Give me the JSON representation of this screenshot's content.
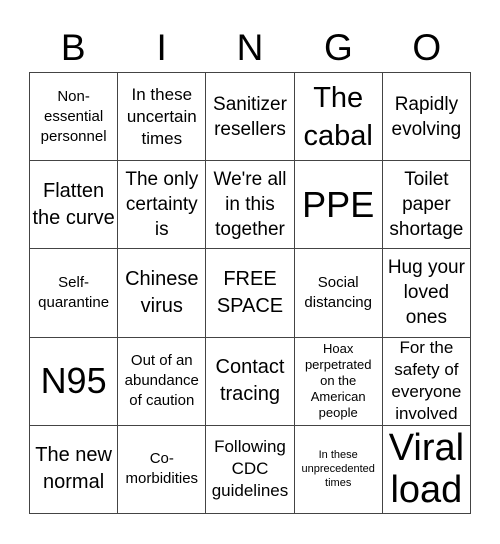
{
  "header": {
    "letters": [
      "B",
      "I",
      "N",
      "G",
      "O"
    ]
  },
  "cells": [
    {
      "text": "Non-essential personnel",
      "size": "fs-sm"
    },
    {
      "text": "In these uncertain times",
      "size": "fs-m"
    },
    {
      "text": "Sanitizer resellers",
      "size": "fs-ml"
    },
    {
      "text": "The cabal",
      "size": "fs-xl"
    },
    {
      "text": "Rapidly evolving",
      "size": "fs-ml"
    },
    {
      "text": "Flatten the curve",
      "size": "fs-l"
    },
    {
      "text": "The only certainty is",
      "size": "fs-ml"
    },
    {
      "text": "We're all in this together",
      "size": "fs-ml"
    },
    {
      "text": "PPE",
      "size": "fs-xxl"
    },
    {
      "text": "Toilet paper shortage",
      "size": "fs-ml"
    },
    {
      "text": "Self-quarantine",
      "size": "fs-sm"
    },
    {
      "text": "Chinese virus",
      "size": "fs-l"
    },
    {
      "text": "FREE SPACE",
      "size": "fs-l"
    },
    {
      "text": "Social distancing",
      "size": "fs-sm"
    },
    {
      "text": "Hug your loved ones",
      "size": "fs-ml"
    },
    {
      "text": "N95",
      "size": "fs-xxl"
    },
    {
      "text": "Out of an abundance of caution",
      "size": "fs-sm"
    },
    {
      "text": "Contact tracing",
      "size": "fs-l"
    },
    {
      "text": "Hoax perpetrated on the American people",
      "size": "fs-s"
    },
    {
      "text": "For the safety of everyone involved",
      "size": "fs-m"
    },
    {
      "text": "The new normal",
      "size": "fs-l"
    },
    {
      "text": "Co-morbidities",
      "size": "fs-sm"
    },
    {
      "text": "Following CDC guidelines",
      "size": "fs-m"
    },
    {
      "text": "In these unprecedented times",
      "size": "fs-xs"
    },
    {
      "text": "Viral load",
      "size": "fs-xxxl"
    }
  ]
}
